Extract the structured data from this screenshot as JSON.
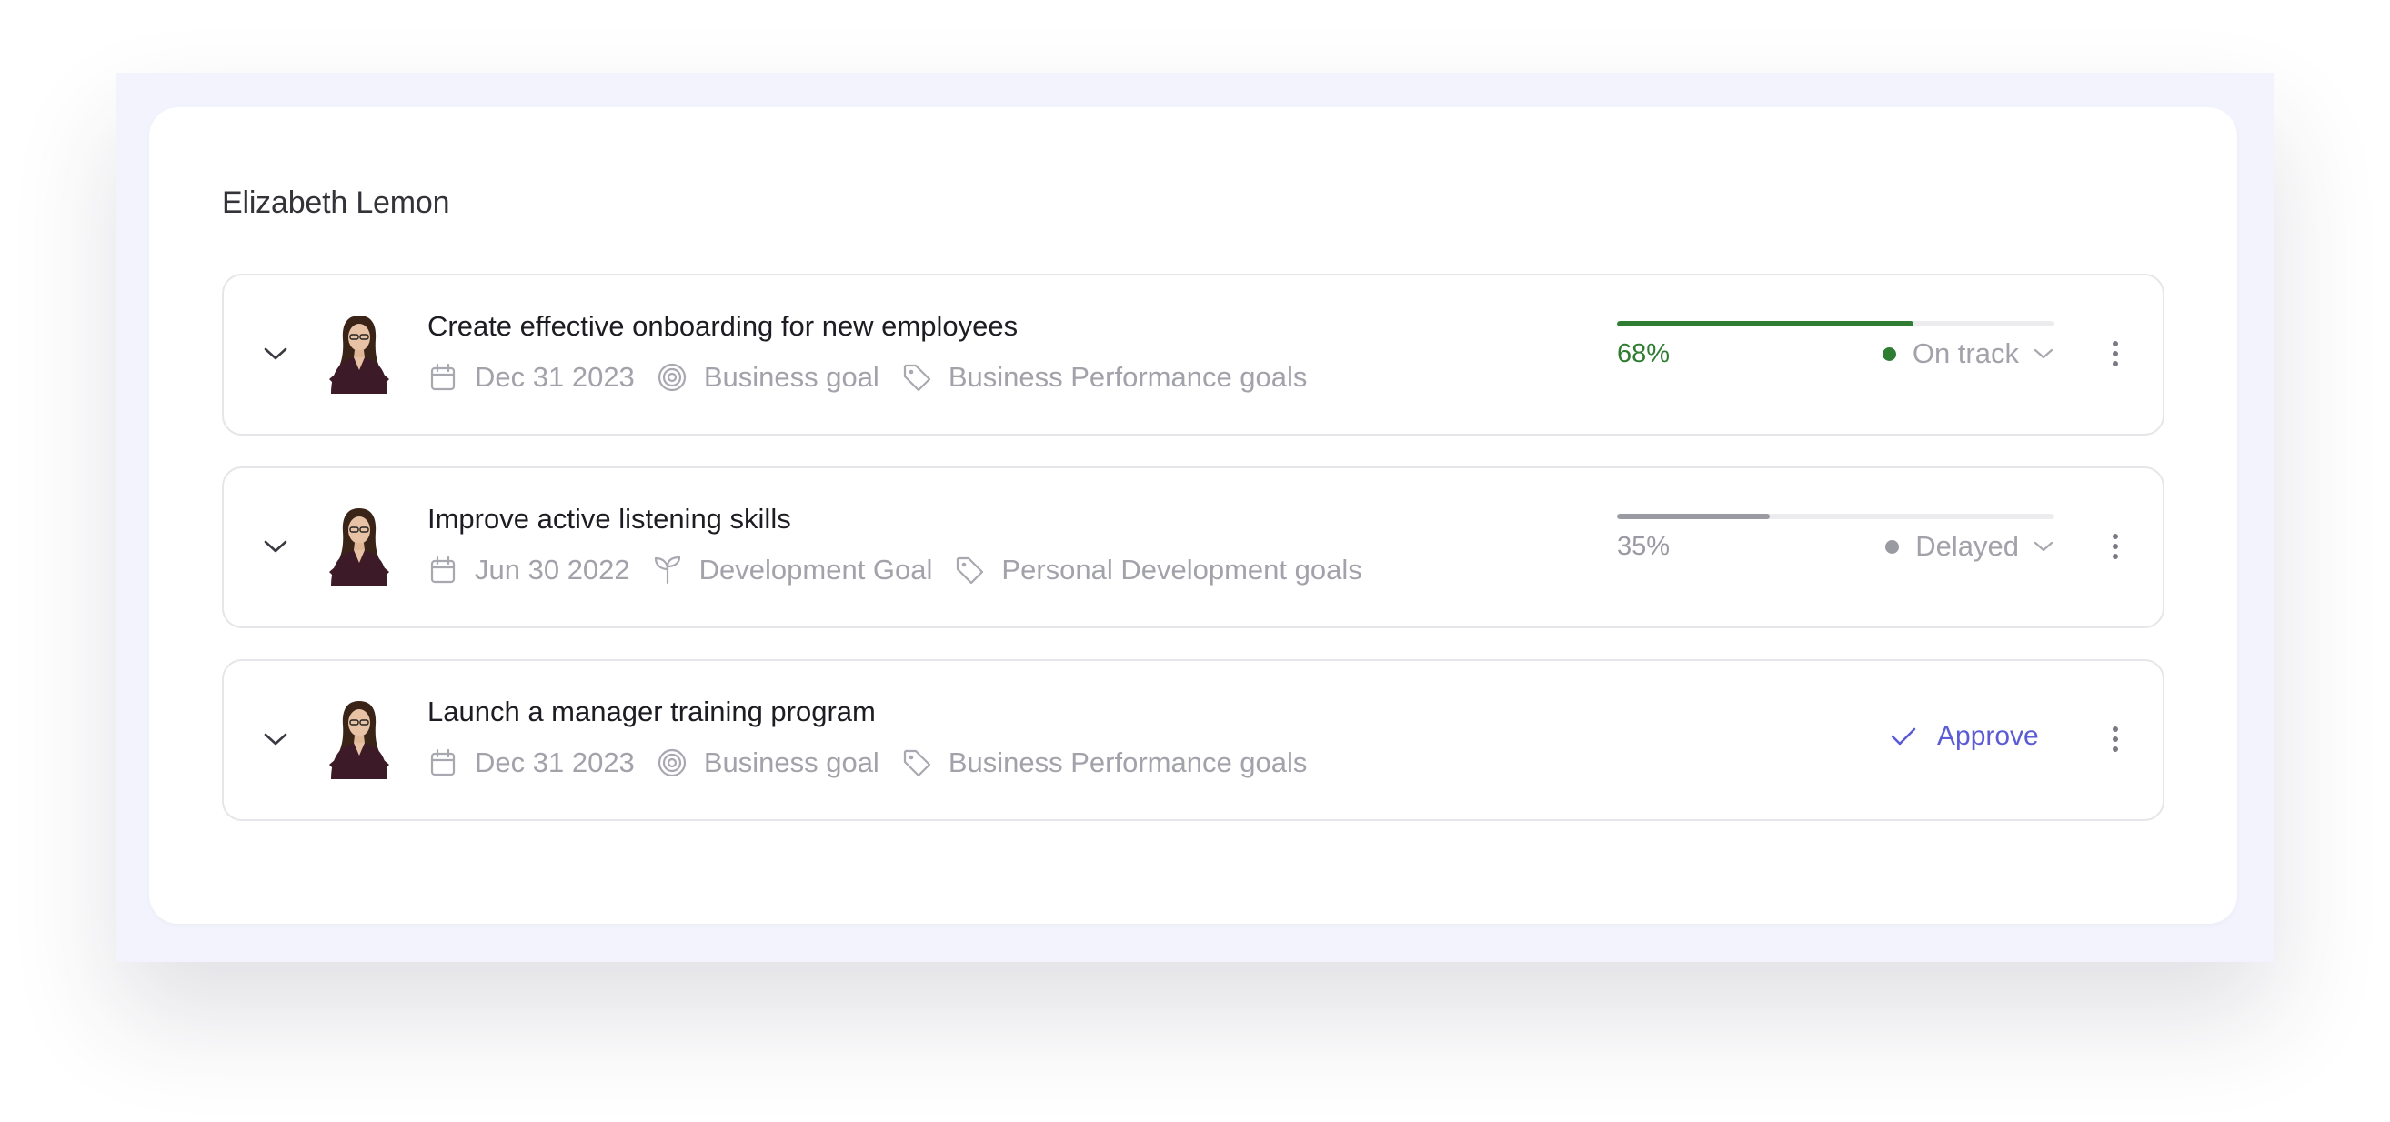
{
  "owner": {
    "name": "Elizabeth Lemon"
  },
  "colors": {
    "on_track": "#2e7d32",
    "delayed": "#9a9aa2",
    "approve": "#5b5bd6",
    "meta_text": "#a2a2aa"
  },
  "goals": [
    {
      "title": "Create effective onboarding for new employees",
      "due_date": "Dec 31 2023",
      "goal_type": "Business goal",
      "goal_type_icon": "target-icon",
      "category": "Business Performance goals",
      "progress": 0.68,
      "progress_label": "68%",
      "status": "On track",
      "status_color": "#2e7d32"
    },
    {
      "title": "Improve active listening skills",
      "due_date": "Jun 30 2022",
      "goal_type": "Development Goal",
      "goal_type_icon": "sprout-icon",
      "category": "Personal Development goals",
      "progress": 0.35,
      "progress_label": "35%",
      "status": "Delayed",
      "status_color": "#9a9aa2"
    },
    {
      "title": "Launch a manager training program",
      "due_date": "Dec 31 2023",
      "goal_type": "Business goal",
      "goal_type_icon": "target-icon",
      "category": "Business Performance goals",
      "action_label": "Approve"
    }
  ]
}
